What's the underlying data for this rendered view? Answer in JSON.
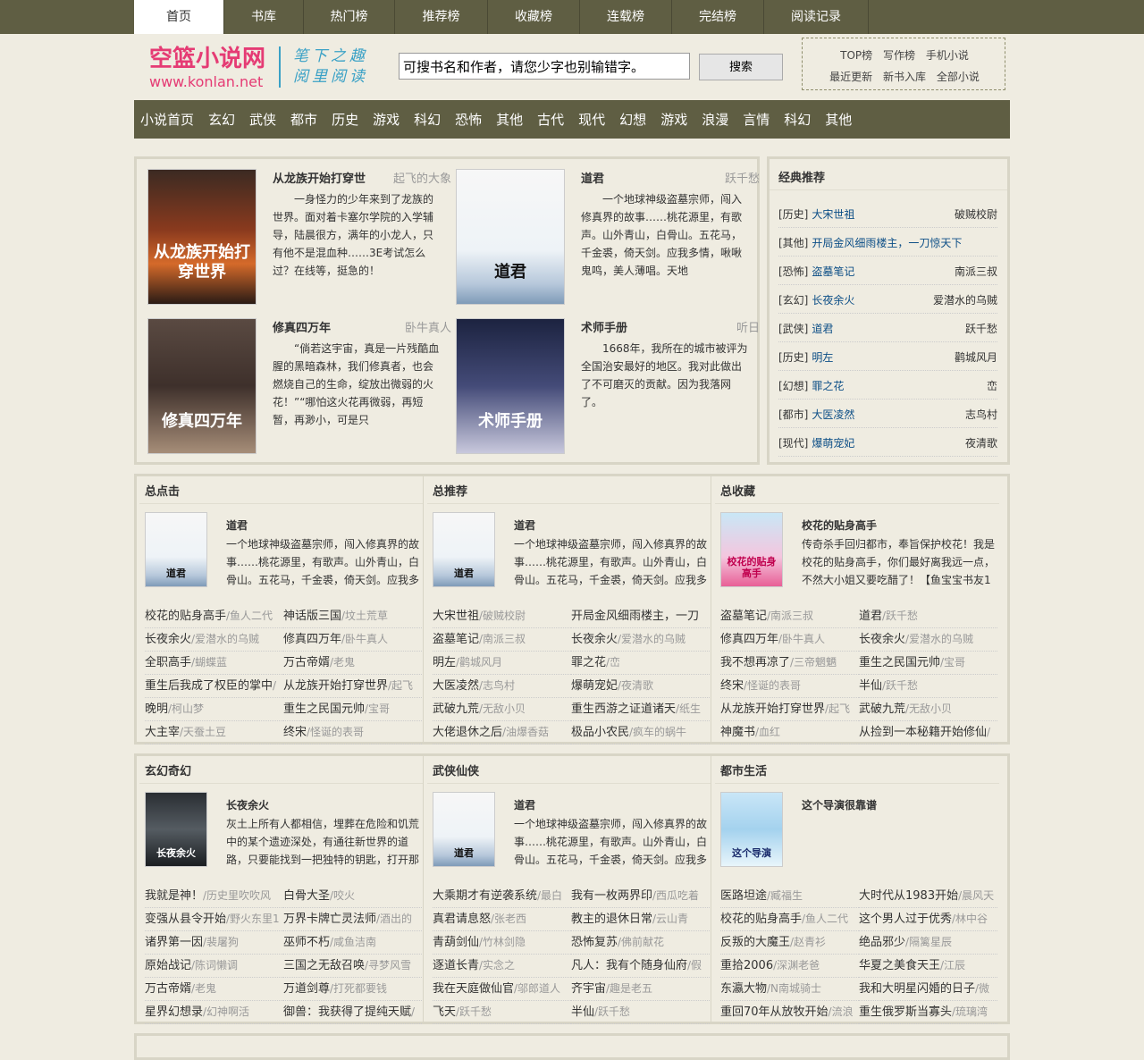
{
  "topnav": [
    "首页",
    "书库",
    "热门榜",
    "推荐榜",
    "收藏榜",
    "连载榜",
    "完结榜",
    "阅读记录"
  ],
  "logo": {
    "name": "空篮小说网",
    "url": "www.konlan.net",
    "slogan1": "笔下之趣",
    "slogan2": "阅里阅读"
  },
  "search": {
    "placeholder": "可搜书名和作者，请您少字也别输错字。",
    "button": "搜索"
  },
  "quicklinks": {
    "row1": [
      "TOP榜",
      "写作榜",
      "手机小说"
    ],
    "row2": [
      "最近更新",
      "新书入库",
      "全部小说"
    ]
  },
  "categories": [
    "小说首页",
    "玄幻",
    "武侠",
    "都市",
    "历史",
    "游戏",
    "科幻",
    "恐怖",
    "其他",
    "古代",
    "现代",
    "幻想",
    "游戏",
    "浪漫",
    "言情",
    "科幻",
    "其他"
  ],
  "featured": [
    {
      "title": "从龙族开始打穿世",
      "author": "起飞的大象",
      "desc": "一身怪力的少年来到了龙族的世界。面对着卡塞尔学院的入学辅导，陆晨很方，满年的小龙人，只有他不是混血种……3E考试怎么过？在线等，挺急的！",
      "cover": "从龙族开始打穿世界"
    },
    {
      "title": "道君",
      "author": "跃千愁",
      "desc": "一个地球神级盗墓宗师，闯入修真界的故事……桃花源里，有歌声。山外青山，白骨山。五花马，千金裘，倚天剑。应我多情，啾啾鬼鸣，美人薄唱。天地",
      "cover": "道君"
    },
    {
      "title": "修真四万年",
      "author": "卧牛真人",
      "desc": "“倘若这宇宙，真是一片残酷血腥的黑暗森林，我们修真者，也会燃烧自己的生命，绽放出微弱的火花！”“哪怕这火花再微弱，再短暂，再渺小，可是只",
      "cover": "修真四万年"
    },
    {
      "title": "术师手册",
      "author": "听日",
      "desc": "1668年，我所在的城市被评为全国治安最好的地区。我对此做出了不可磨灭的贡献。因为我落网了。",
      "cover": "术师手册"
    }
  ],
  "classic": {
    "title": "经典推荐",
    "items": [
      {
        "tag": "[历史]",
        "book": "大宋世祖",
        "author": "破贼校尉"
      },
      {
        "tag": "[其他]",
        "book": "开局金风细雨楼主，一刀惊天下",
        "author": ""
      },
      {
        "tag": "[恐怖]",
        "book": "盗墓笔记",
        "author": "南派三叔"
      },
      {
        "tag": "[玄幻]",
        "book": "长夜余火",
        "author": "爱潜水的乌贼"
      },
      {
        "tag": "[武侠]",
        "book": "道君",
        "author": "跃千愁"
      },
      {
        "tag": "[历史]",
        "book": "明左",
        "author": "鹳城风月"
      },
      {
        "tag": "[幻想]",
        "book": "罪之花",
        "author": "峦"
      },
      {
        "tag": "[都市]",
        "book": "大医凌然",
        "author": "志鸟村"
      },
      {
        "tag": "[现代]",
        "book": "爆萌宠妃",
        "author": "夜清歌"
      }
    ]
  },
  "ranks": [
    {
      "head": "总点击",
      "title": "道君",
      "cover": "道君",
      "desc": "一个地球神级盗墓宗师，闯入修真界的故事……桃花源里，有歌声。山外青山，白骨山。五花马，千金裘，倚天剑。应我多情",
      "list": [
        [
          "校花的贴身高手",
          "/鱼人二代"
        ],
        [
          "神话版三国",
          "/坟土荒草"
        ],
        [
          "长夜余火",
          "/爱潜水的乌贼"
        ],
        [
          "修真四万年",
          "/卧牛真人"
        ],
        [
          "全职高手",
          "/蝴蝶蓝"
        ],
        [
          "万古帝婿",
          "/老鬼"
        ],
        [
          "重生后我成了权臣的掌中",
          "/"
        ],
        [
          "从龙族开始打穿世界",
          "/起飞"
        ],
        [
          "晚明",
          "/柯山梦"
        ],
        [
          "重生之民国元帅",
          "/宝哥"
        ],
        [
          "大主宰",
          "/天蚕土豆"
        ],
        [
          "终宋",
          "/怪诞的表哥"
        ]
      ]
    },
    {
      "head": "总推荐",
      "title": "道君",
      "cover": "道君",
      "desc": "一个地球神级盗墓宗师，闯入修真界的故事……桃花源里，有歌声。山外青山，白骨山。五花马，千金裘，倚天剑。应我多情",
      "list": [
        [
          "大宋世祖",
          "/破贼校尉"
        ],
        [
          "开局金风细雨楼主，一刀",
          ""
        ],
        [
          "盗墓笔记",
          "/南派三叔"
        ],
        [
          "长夜余火",
          "/爱潜水的乌贼"
        ],
        [
          "明左",
          "/鹳城风月"
        ],
        [
          "罪之花",
          "/峦"
        ],
        [
          "大医凌然",
          "/志鸟村"
        ],
        [
          "爆萌宠妃",
          "/夜清歌"
        ],
        [
          "武破九荒",
          "/无敌小贝"
        ],
        [
          "重生西游之证道诸天",
          "/纸生"
        ],
        [
          "大佬退休之后",
          "/油爆香菇"
        ],
        [
          "极品小农民",
          "/疯车的蜗牛"
        ]
      ]
    },
    {
      "head": "总收藏",
      "title": "校花的贴身高手",
      "cover": "校花的贴身高手",
      "desc": "传奇杀手回归都市，奉旨保护校花！我是校花的贴身高手，你们最好离我远一点，不然大小姐又要吃醋了！【鱼宝宝书友1",
      "list": [
        [
          "盗墓笔记",
          "/南派三叔"
        ],
        [
          "道君",
          "/跃千愁"
        ],
        [
          "修真四万年",
          "/卧牛真人"
        ],
        [
          "长夜余火",
          "/爱潜水的乌贼"
        ],
        [
          "我不想再凉了",
          "/三帝魍魉"
        ],
        [
          "重生之民国元帅",
          "/宝哥"
        ],
        [
          "终宋",
          "/怪诞的表哥"
        ],
        [
          "半仙",
          "/跃千愁"
        ],
        [
          "从龙族开始打穿世界",
          "/起飞"
        ],
        [
          "武破九荒",
          "/无敌小贝"
        ],
        [
          "神魔书",
          "/血红"
        ],
        [
          "从捡到一本秘籍开始修仙",
          "/"
        ]
      ]
    }
  ],
  "genres": [
    {
      "head": "玄幻奇幻",
      "title": "长夜余火",
      "cover": "长夜余火",
      "desc": "灰土上所有人都相信，埋葬在危险和饥荒中的某个遗迹深处，有通往新世界的道路，只要能找到一把独特的钥匙，打开那",
      "list": [
        [
          "我就是神！",
          "/历史里吹吹风"
        ],
        [
          "白骨大圣",
          "/咬火"
        ],
        [
          "变强从县令开始",
          "/野火东里1"
        ],
        [
          "万界卡牌亡灵法师",
          "/酒出的"
        ],
        [
          "诸界第一因",
          "/裴屠狗"
        ],
        [
          "巫师不朽",
          "/咸鱼洁南"
        ],
        [
          "原始战记",
          "/陈词懒调"
        ],
        [
          "三国之无敌召唤",
          "/寻梦风雪"
        ],
        [
          "万古帝婿",
          "/老鬼"
        ],
        [
          "万道剑尊",
          "/打死都要钱"
        ],
        [
          "星界幻想录",
          "/幻神啊活"
        ],
        [
          "御兽：我获得了提纯天赋",
          "/"
        ]
      ]
    },
    {
      "head": "武侠仙侠",
      "title": "道君",
      "cover": "道君",
      "desc": "一个地球神级盗墓宗师，闯入修真界的故事……桃花源里，有歌声。山外青山，白骨山。五花马，千金裘，倚天剑。应我多情",
      "list": [
        [
          "大乘期才有逆袭系统",
          "/最白"
        ],
        [
          "我有一枚两界印",
          "/西瓜吃着"
        ],
        [
          "真君请息怒",
          "/张老西"
        ],
        [
          "教主的退休日常",
          "/云山青"
        ],
        [
          "青葫剑仙",
          "/竹林剑隐"
        ],
        [
          "恐怖复苏",
          "/佛前献花"
        ],
        [
          "逐道长青",
          "/实念之"
        ],
        [
          "凡人：我有个随身仙府",
          "/假"
        ],
        [
          "我在天庭做仙官",
          "/邬郎道人"
        ],
        [
          "齐宇宙",
          "/趣是老五"
        ],
        [
          "飞天",
          "/跃千愁"
        ],
        [
          "半仙",
          "/跃千愁"
        ]
      ]
    },
    {
      "head": "都市生活",
      "title": "这个导演很靠谱",
      "cover": "这个导演",
      "desc": "",
      "list": [
        [
          "医路坦途",
          "/臧福生"
        ],
        [
          "大时代从1983开始",
          "/晨风天"
        ],
        [
          "校花的贴身高手",
          "/鱼人二代"
        ],
        [
          "这个男人过于优秀",
          "/林中谷"
        ],
        [
          "反叛的大魔王",
          "/赵青衫"
        ],
        [
          "绝品邪少",
          "/隔篱星辰"
        ],
        [
          "重拾2006",
          "/深渊老爸"
        ],
        [
          "华夏之美食天王",
          "/江辰"
        ],
        [
          "东瀛大物",
          "/N南城骑士"
        ],
        [
          "我和大明星闪婚的日子",
          "/微"
        ],
        [
          "重回70年从放牧开始",
          "/流浪"
        ],
        [
          "重生俄罗斯当寡头",
          "/琉璃湾"
        ]
      ]
    }
  ]
}
